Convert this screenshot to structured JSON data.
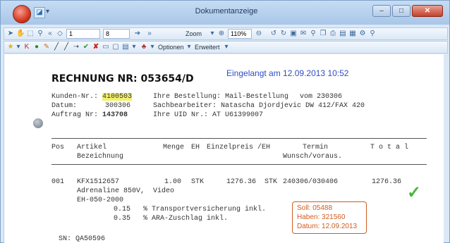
{
  "window": {
    "title": "Dokumentanzeige"
  },
  "toolbar1": {
    "page_field": "1",
    "page_total": "8",
    "zoom_label": "Zoom",
    "zoom_value": "110%"
  },
  "toolbar2": {
    "optionen_label": "Optionen",
    "erweitert_label": "Erweitert"
  },
  "document": {
    "title": "RECHNUNG NR: 053654/D",
    "received_stamp": "Eingelangt am 12.09.2013 10:52",
    "header": {
      "customer_label": "Kunden-Nr.:",
      "customer_number": "4100503",
      "order_type": "Ihre Bestellung: Mail-Bestellung",
      "order_date": "vom 230306",
      "date_label": "Datum:",
      "date_value": "300306",
      "clerk": "Sachbearbeiter: Natascha Djordjevic DW 412/FAX 420",
      "order_no_label": "Auftrag Nr:",
      "order_no": "143708",
      "uid": "Ihre UID Nr.: AT U61399007"
    },
    "columns": {
      "pos": "Pos",
      "article": "Artikel",
      "description": "Bezeichnung",
      "qty": "Menge",
      "unit": "EH",
      "unit_price": "Einzelpreis /EH",
      "date": "Termin",
      "date_sub": "Wunsch/voraus.",
      "total": "T o t a l"
    },
    "line_item": {
      "pos": "001",
      "article": "KFX1512657",
      "qty": "1.00",
      "unit": "STK",
      "price": "1276.36",
      "price_unit": "STK",
      "dates": "240306/030406",
      "total": "1276.36",
      "desc1": "Adrenaline 850V,  Video",
      "desc2": "EH-050-2000",
      "extra1": "0.15   % Transportversicherung inkl.",
      "extra2": "0.35   % ARA-Zuschlag inkl."
    },
    "serial": "SN: QA50596",
    "booking": {
      "soll": "Soll:    05488",
      "haben": "Haben: 321560",
      "datum": "Datum: 12.09.2013"
    },
    "check_glyph": "✓"
  },
  "colors": {
    "stamp_blue": "#2f4ec4",
    "booking_orange": "#d05c1e",
    "highlight_yellow": "#f4f16a",
    "check_green": "#47b838"
  }
}
